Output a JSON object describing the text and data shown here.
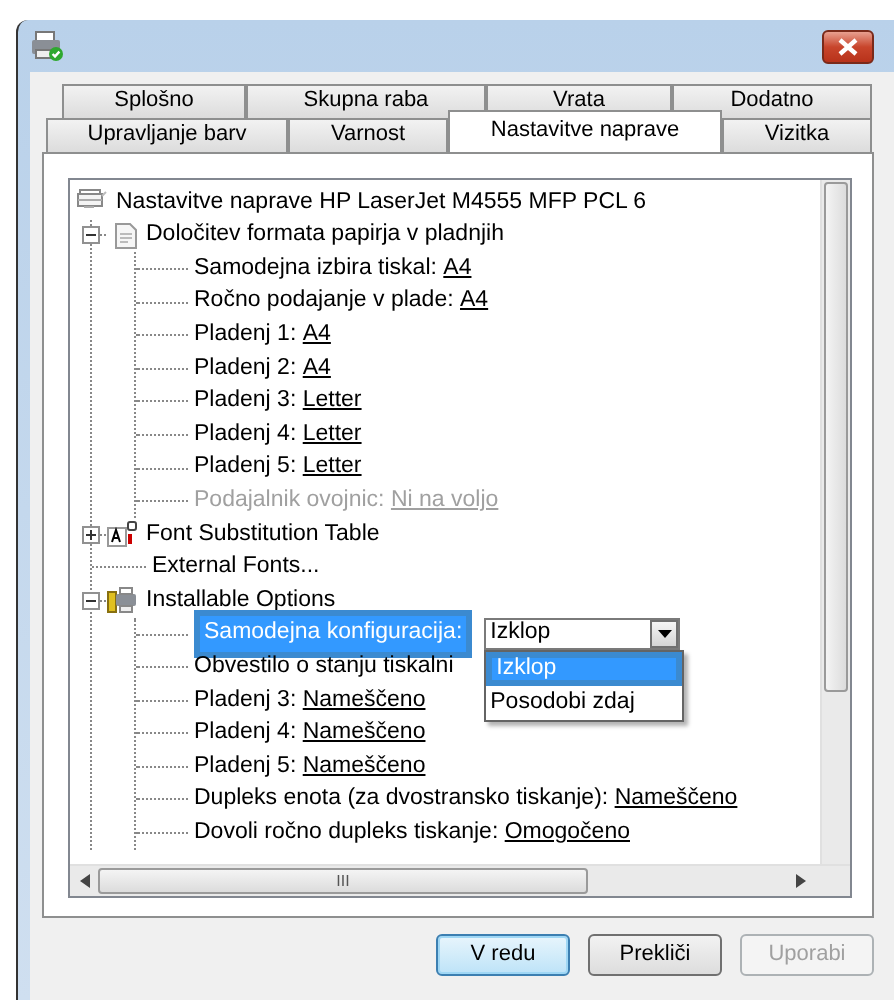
{
  "tabs": [
    [
      {
        "label": "Splošno",
        "selected": false
      },
      {
        "label": "Skupna raba",
        "selected": false
      },
      {
        "label": "Vrata",
        "selected": false
      },
      {
        "label": "Dodatno",
        "selected": false
      }
    ],
    [
      {
        "label": "Upravljanje barv",
        "selected": false
      },
      {
        "label": "Varnost",
        "selected": false
      },
      {
        "label": "Nastavitve naprave",
        "selected": true
      },
      {
        "label": "Vizitka",
        "selected": false
      }
    ]
  ],
  "tree": {
    "label": "Nastavitve naprave HP LaserJet M4555 MFP PCL 6",
    "children": [
      {
        "label": "Določitev formata papirja v pladnjih",
        "expanded": true,
        "children": [
          {
            "label": "Samodejna izbira tiskal:",
            "value": "A4",
            "disabled": false,
            "selected": false
          },
          {
            "label": "Ročno podajanje v plade:",
            "value": "A4",
            "disabled": false,
            "selected": false
          },
          {
            "label": "Pladenj 1:",
            "value": "A4",
            "disabled": false,
            "selected": false
          },
          {
            "label": "Pladenj 2:",
            "value": "A4",
            "disabled": false,
            "selected": false
          },
          {
            "label": "Pladenj 3:",
            "value": "Letter",
            "disabled": false,
            "selected": false
          },
          {
            "label": "Pladenj 4:",
            "value": "Letter",
            "disabled": false,
            "selected": false
          },
          {
            "label": "Pladenj 5:",
            "value": "Letter",
            "disabled": false,
            "selected": false
          },
          {
            "label": "Podajalnik ovojnic:",
            "value": "Ni na voljo",
            "disabled": true,
            "selected": false
          }
        ]
      },
      {
        "label": "Font Substitution Table",
        "expanded": false
      },
      {
        "label": "External Fonts..."
      },
      {
        "label": "Installable Options",
        "expanded": true,
        "children": [
          {
            "kind": "combo",
            "label": "Samodejna konfiguracija:",
            "value": "Izklop",
            "disabled": false,
            "selected": true,
            "highlighted": true,
            "dropdown": [
              {
                "label": "Izklop",
                "selected": true,
                "highlighted": true
              },
              {
                "label": "Posodobi zdaj",
                "selected": false,
                "highlighted": false
              }
            ]
          },
          {
            "label": "Obvestilo o stanju tiskalni",
            "disabled": false,
            "selected": false
          },
          {
            "label": "Pladenj 3:",
            "value": "Nameščeno",
            "disabled": false,
            "selected": false
          },
          {
            "label": "Pladenj 4:",
            "value": "Nameščeno",
            "disabled": false,
            "selected": false
          },
          {
            "label": "Pladenj 5:",
            "value": "Nameščeno",
            "disabled": false,
            "selected": false
          },
          {
            "label": "Dupleks enota (za dvostransko tiskanje):",
            "value": "Nameščeno",
            "disabled": false,
            "selected": false
          },
          {
            "label": "Dovoli ročno dupleks tiskanje:",
            "value": "Omogočeno",
            "disabled": false,
            "selected": false
          }
        ]
      }
    ]
  },
  "hscroll": {
    "grip": "III"
  },
  "buttons": [
    {
      "label": "V redu",
      "default": true,
      "disabled": false
    },
    {
      "label": "Prekliči",
      "default": false,
      "disabled": false
    },
    {
      "label": "Uporabi",
      "default": false,
      "disabled": true
    }
  ]
}
